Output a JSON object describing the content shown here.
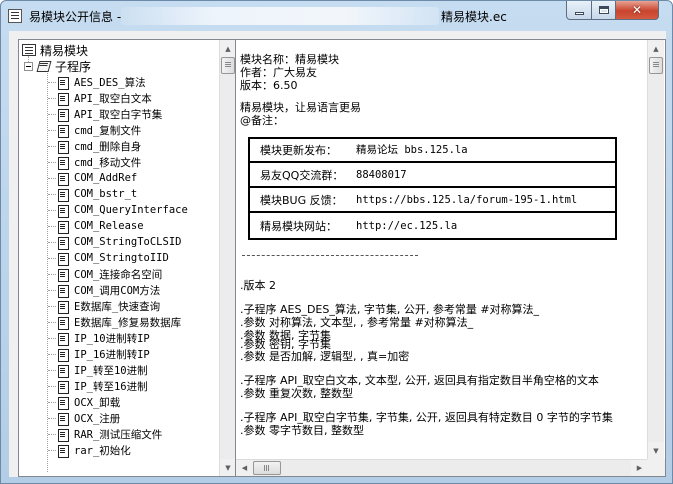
{
  "window": {
    "title_left": "易模块公开信息 -",
    "title_right": "精易模块.ec",
    "buttons": {
      "minimize": "",
      "maximize": "",
      "close": "✕"
    }
  },
  "tree": {
    "root": "精易模块",
    "category": "子程序",
    "items": [
      "AES_DES_算法",
      "API_取空白文本",
      "API_取空白字节集",
      "cmd_复制文件",
      "cmd_删除自身",
      "cmd_移动文件",
      "COM_AddRef",
      "COM_bstr_t",
      "COM_QueryInterface",
      "COM_Release",
      "COM_StringToCLSID",
      "COM_StringtoIID",
      "COM_连接命名空间",
      "COM_调用COM方法",
      "E数据库_快速查询",
      "E数据库_修复易数据库",
      "IP_10进制转IP",
      "IP_16进制转IP",
      "IP_转至10进制",
      "IP_转至16进制",
      "OCX_卸载",
      "OCX_注册",
      "RAR_测试压缩文件",
      "rar_初始化"
    ]
  },
  "detail": {
    "header_lines": [
      "模块名称：精易模块",
      "作者：广大易友",
      "版本：6.50"
    ],
    "description": "精易模块，让易语言更易",
    "remark": "@备注：",
    "info_rows": [
      {
        "label": "模块更新发布：",
        "value": "精易论坛  bbs.125.la"
      },
      {
        "label": "易友QQ交流群：",
        "value": "88408017"
      },
      {
        "label": "模块BUG 反馈：",
        "value": "https://bbs.125.la/forum-195-1.html"
      },
      {
        "label": "精易模块网站：",
        "value": "http://ec.125.la"
      }
    ],
    "version_line": ".版本 2",
    "code_lines": [
      ".子程序 AES_DES_算法, 字节集, 公开, 参考常量  #对称算法_",
      ".参数 对称算法, 文本型, , 参考常量  #对称算法_",
      ".参数 数据, 字节集",
      ".参数 密钥, 字节集",
      ".参数 是否加解, 逻辑型, , 真=加密",
      ".子程序 API_取空白文本, 文本型, 公开, 返回具有指定数目半角空格的文本",
      ".参数 重复次数, 整数型",
      ".子程序 API_取空白字节集, 字节集, 公开, 返回具有特定数目 0 字节的字节集",
      ".参数 零字节数目, 整数型"
    ]
  }
}
